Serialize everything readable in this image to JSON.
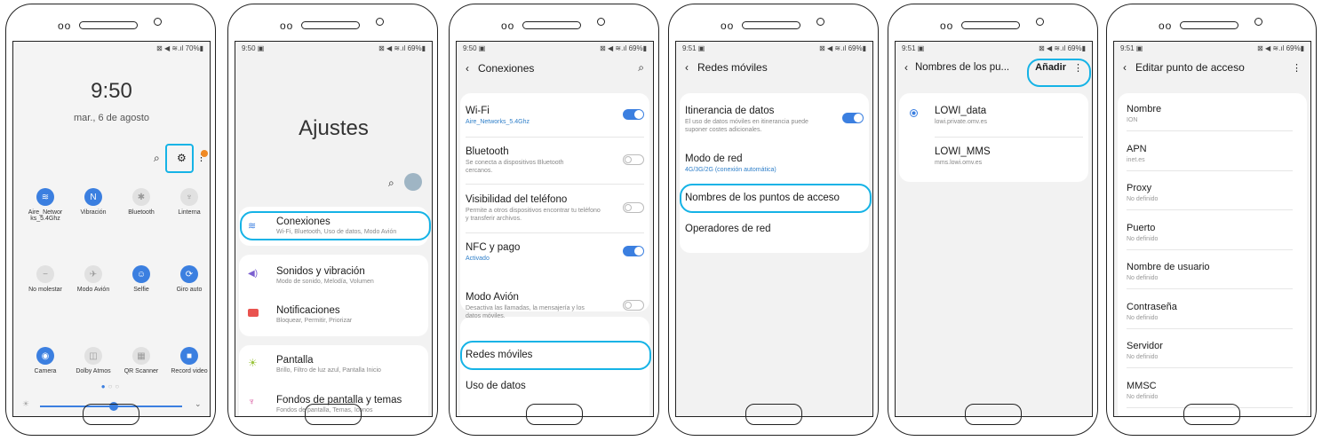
{
  "colors": {
    "accent": "#3b7fe0",
    "highlight": "#15b3e6"
  },
  "s1": {
    "status_right": "⊠ ◀ ≋.ıl 70%▮",
    "time": "9:50",
    "date": "mar., 6 de agosto",
    "tiles": [
      {
        "label": "Aire_Networ ks_5.4Ghz",
        "icon": "wifi-icon",
        "glyph": "≋",
        "on": true
      },
      {
        "label": "Vibración",
        "icon": "vibration-icon",
        "glyph": "N",
        "on": true
      },
      {
        "label": "Bluetooth",
        "icon": "bluetooth-icon",
        "glyph": "✱",
        "on": false
      },
      {
        "label": "Linterna",
        "icon": "flashlight-icon",
        "glyph": "♆",
        "on": false
      },
      {
        "label": "No molestar",
        "icon": "do-not-disturb-icon",
        "glyph": "−",
        "on": false
      },
      {
        "label": "Modo Avión",
        "icon": "airplane-icon",
        "glyph": "✈",
        "on": false
      },
      {
        "label": "Selfie",
        "icon": "selfie-icon",
        "glyph": "☺",
        "on": true
      },
      {
        "label": "Giro auto",
        "icon": "rotate-icon",
        "glyph": "⟳",
        "on": true
      },
      {
        "label": "Camera",
        "icon": "camera-icon",
        "glyph": "◉",
        "on": true
      },
      {
        "label": "Dolby Atmos",
        "icon": "dolby-icon",
        "glyph": "◫",
        "on": false
      },
      {
        "label": "QR Scanner",
        "icon": "qr-icon",
        "glyph": "▦",
        "on": false
      },
      {
        "label": "Record video",
        "icon": "record-video-icon",
        "glyph": "■",
        "on": true
      }
    ]
  },
  "s2": {
    "time": "9:50 ▣",
    "status_right": "⊠ ◀ ≋.ıl 69%▮",
    "title": "Ajustes",
    "items": [
      {
        "label": "Conexiones",
        "sub": "Wi-Fi, Bluetooth, Uso de datos, Modo Avión"
      },
      {
        "label": "Sonidos y vibración",
        "sub": "Modo de sonido, Melodía, Volumen"
      },
      {
        "label": "Notificaciones",
        "sub": "Bloquear, Permitir, Priorizar"
      },
      {
        "label": "Pantalla",
        "sub": "Brillo, Filtro de luz azul, Pantalla Inicio"
      },
      {
        "label": "Fondos de pantalla y temas",
        "sub": "Fondos de pantalla, Temas, Iconos"
      }
    ]
  },
  "s3": {
    "time": "9:50 ▣",
    "status_right": "⊠ ◀ ≋.ıl 69%▮",
    "header": "Conexiones",
    "items": [
      {
        "label": "Wi-Fi",
        "sub": "Aire_Networks_5.4Ghz"
      },
      {
        "label": "Bluetooth",
        "sub": "Se conecta a dispositivos Bluetooth cercanos."
      },
      {
        "label": "Visibilidad del teléfono",
        "sub": "Permite a otros dispositivos encontrar tu teléfono y transferir archivos."
      },
      {
        "label": "NFC y pago",
        "sub": "Activado"
      },
      {
        "label": "Modo Avión",
        "sub": "Desactiva las llamadas, la mensajería y los datos móviles."
      },
      {
        "label": "Redes móviles"
      },
      {
        "label": "Uso de datos"
      }
    ]
  },
  "s4": {
    "time": "9:51 ▣",
    "status_right": "⊠ ◀ ≋.ıl 69%▮",
    "header": "Redes móviles",
    "items": [
      {
        "label": "Itinerancia de datos",
        "sub": "El uso de datos móviles en itinerancia puede suponer costes adicionales."
      },
      {
        "label": "Modo de red",
        "sub": "4G/3G/2G (conexión automática)"
      },
      {
        "label": "Nombres de los puntos de acceso"
      },
      {
        "label": "Operadores de red"
      }
    ]
  },
  "s5": {
    "time": "9:51 ▣",
    "status_right": "⊠ ◀ ≋.ıl 69%▮",
    "header": "Nombres de los pu...",
    "add": "Añadir",
    "items": [
      {
        "label": "LOWI_data",
        "sub": "lowi.private.omv.es"
      },
      {
        "label": "LOWI_MMS",
        "sub": "mms.lowi.omv.es"
      }
    ]
  },
  "s6": {
    "time": "9:51 ▣",
    "status_right": "⊠ ◀ ≋.ıl 69%▮",
    "header": "Editar punto de acceso",
    "fields": [
      {
        "label": "Nombre",
        "value": "ION"
      },
      {
        "label": "APN",
        "value": "inet.es"
      },
      {
        "label": "Proxy",
        "value": "No definido"
      },
      {
        "label": "Puerto",
        "value": "No definido"
      },
      {
        "label": "Nombre de usuario",
        "value": "No definido"
      },
      {
        "label": "Contraseña",
        "value": "No definido"
      },
      {
        "label": "Servidor",
        "value": "No definido"
      },
      {
        "label": "MMSC",
        "value": "No definido"
      }
    ]
  }
}
